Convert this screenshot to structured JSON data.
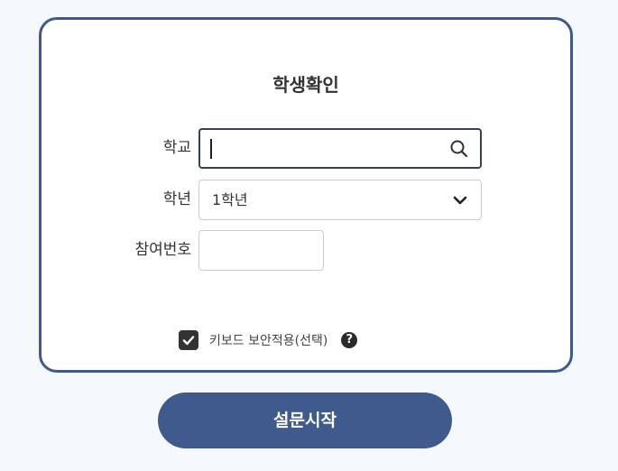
{
  "form": {
    "title": "학생확인",
    "school_label": "학교",
    "school_value": "",
    "grade_label": "학년",
    "grade_selected": "1학년",
    "participant_label": "참여번호",
    "participant_value": ""
  },
  "keyboard_security": {
    "label": "키보드 보안적용(선택)",
    "checked": true,
    "help_glyph": "?"
  },
  "actions": {
    "start_label": "설문시작"
  },
  "icons": {
    "search": "search-icon",
    "dropdown": "chevron-down-icon",
    "check": "check-icon",
    "help": "question-circle-icon"
  },
  "colors": {
    "accent": "#3f5a8c",
    "page_background": "#f5f9fd",
    "input_active_border": "#33415e",
    "checkbox": "#333333"
  }
}
